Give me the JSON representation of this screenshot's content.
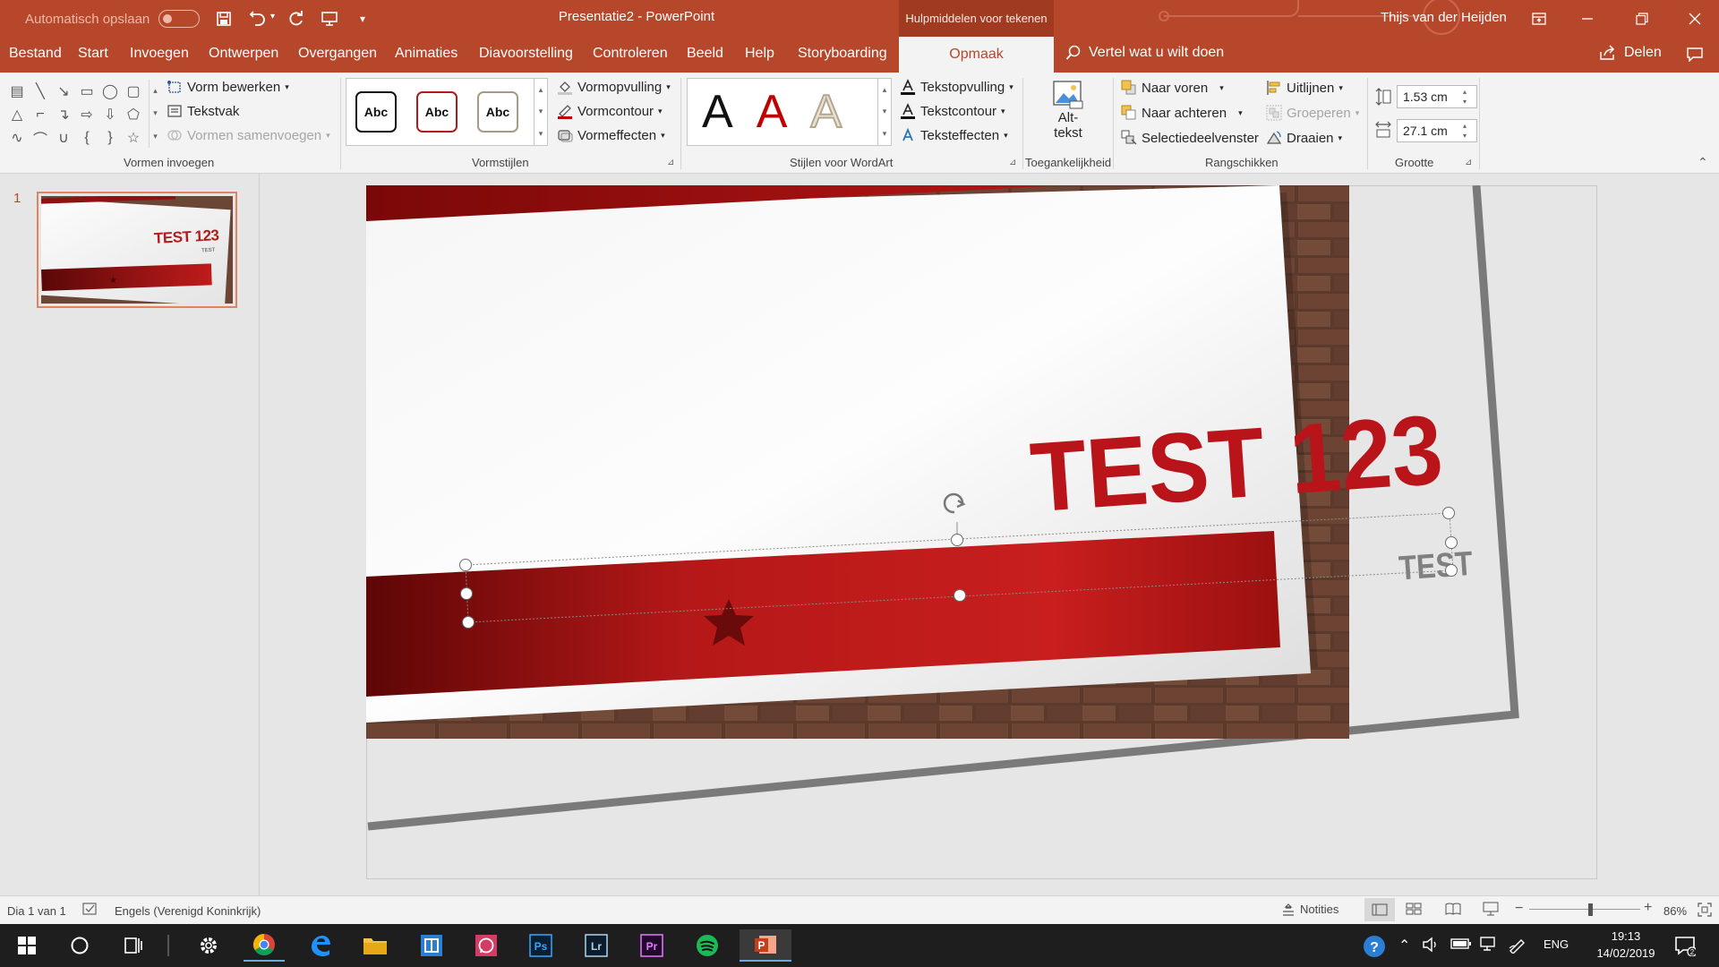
{
  "titlebar": {
    "autosave_label": "Automatisch opslaan",
    "doc_title": "Presentatie2 - PowerPoint",
    "contextual_label": "Hulpmiddelen voor tekenen",
    "user_name": "Thijs van der Heijden"
  },
  "tabs": {
    "file": "Bestand",
    "items": [
      "Start",
      "Invoegen",
      "Ontwerpen",
      "Overgangen",
      "Animaties",
      "Diavoorstelling",
      "Controleren",
      "Beeld",
      "Help",
      "Storyboarding"
    ],
    "active": "Opmaak",
    "tell_me": "Vertel wat u wilt doen",
    "share": "Delen"
  },
  "ribbon": {
    "insert_shapes": {
      "edit_shape": "Vorm bewerken",
      "textbox": "Tekstvak",
      "merge_shapes": "Vormen samenvoegen",
      "group_label": "Vormen invoegen"
    },
    "shape_styles": {
      "sample": "Abc",
      "fill": "Vormopvulling",
      "outline": "Vormcontour",
      "effects": "Vormeffecten",
      "group_label": "Vormstijlen"
    },
    "wordart": {
      "sample": "A",
      "text_fill": "Tekstopvulling",
      "text_outline": "Tekstcontour",
      "text_effects": "Teksteffecten",
      "group_label": "Stijlen voor WordArt"
    },
    "accessibility": {
      "alt_text_line1": "Alt-",
      "alt_text_line2": "tekst",
      "group_label": "Toegankelijkheid"
    },
    "arrange": {
      "bring_forward": "Naar voren",
      "send_backward": "Naar achteren",
      "selection_pane": "Selectiedeelvenster",
      "align": "Uitlijnen",
      "group": "Groeperen",
      "rotate": "Draaien",
      "group_label": "Rangschikken"
    },
    "size": {
      "height": "1.53 cm",
      "width": "27.1 cm",
      "group_label": "Grootte"
    }
  },
  "thumbnails": [
    {
      "number": "1",
      "title": "TEST 123",
      "subtitle": "TEST"
    }
  ],
  "slide": {
    "title": "TEST 123",
    "subtitle": "TEST"
  },
  "status": {
    "slide_info": "Dia 1 van 1",
    "language": "Engels (Verenigd Koninkrijk)",
    "notes": "Notities",
    "zoom": "86%",
    "zoom_fraction": 0.55
  },
  "taskbar": {
    "lang": "ENG",
    "time": "19:13",
    "date": "14/02/2019"
  },
  "colors": {
    "accent": "#b7472a",
    "slide_red": "#b01c1c",
    "slide_dark_red": "#6e0a0a"
  }
}
